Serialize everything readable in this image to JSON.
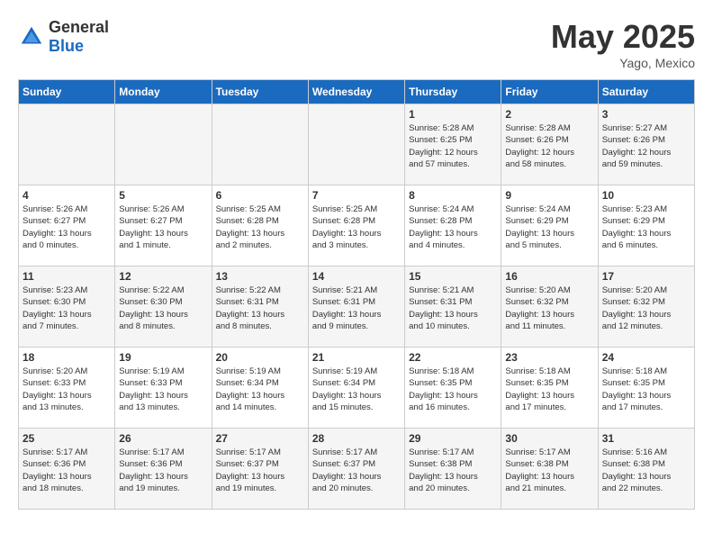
{
  "header": {
    "logo_general": "General",
    "logo_blue": "Blue",
    "month": "May 2025",
    "location": "Yago, Mexico"
  },
  "weekdays": [
    "Sunday",
    "Monday",
    "Tuesday",
    "Wednesday",
    "Thursday",
    "Friday",
    "Saturday"
  ],
  "weeks": [
    [
      {
        "day": "",
        "info": ""
      },
      {
        "day": "",
        "info": ""
      },
      {
        "day": "",
        "info": ""
      },
      {
        "day": "",
        "info": ""
      },
      {
        "day": "1",
        "info": "Sunrise: 5:28 AM\nSunset: 6:25 PM\nDaylight: 12 hours\nand 57 minutes."
      },
      {
        "day": "2",
        "info": "Sunrise: 5:28 AM\nSunset: 6:26 PM\nDaylight: 12 hours\nand 58 minutes."
      },
      {
        "day": "3",
        "info": "Sunrise: 5:27 AM\nSunset: 6:26 PM\nDaylight: 12 hours\nand 59 minutes."
      }
    ],
    [
      {
        "day": "4",
        "info": "Sunrise: 5:26 AM\nSunset: 6:27 PM\nDaylight: 13 hours\nand 0 minutes."
      },
      {
        "day": "5",
        "info": "Sunrise: 5:26 AM\nSunset: 6:27 PM\nDaylight: 13 hours\nand 1 minute."
      },
      {
        "day": "6",
        "info": "Sunrise: 5:25 AM\nSunset: 6:28 PM\nDaylight: 13 hours\nand 2 minutes."
      },
      {
        "day": "7",
        "info": "Sunrise: 5:25 AM\nSunset: 6:28 PM\nDaylight: 13 hours\nand 3 minutes."
      },
      {
        "day": "8",
        "info": "Sunrise: 5:24 AM\nSunset: 6:28 PM\nDaylight: 13 hours\nand 4 minutes."
      },
      {
        "day": "9",
        "info": "Sunrise: 5:24 AM\nSunset: 6:29 PM\nDaylight: 13 hours\nand 5 minutes."
      },
      {
        "day": "10",
        "info": "Sunrise: 5:23 AM\nSunset: 6:29 PM\nDaylight: 13 hours\nand 6 minutes."
      }
    ],
    [
      {
        "day": "11",
        "info": "Sunrise: 5:23 AM\nSunset: 6:30 PM\nDaylight: 13 hours\nand 7 minutes."
      },
      {
        "day": "12",
        "info": "Sunrise: 5:22 AM\nSunset: 6:30 PM\nDaylight: 13 hours\nand 8 minutes."
      },
      {
        "day": "13",
        "info": "Sunrise: 5:22 AM\nSunset: 6:31 PM\nDaylight: 13 hours\nand 8 minutes."
      },
      {
        "day": "14",
        "info": "Sunrise: 5:21 AM\nSunset: 6:31 PM\nDaylight: 13 hours\nand 9 minutes."
      },
      {
        "day": "15",
        "info": "Sunrise: 5:21 AM\nSunset: 6:31 PM\nDaylight: 13 hours\nand 10 minutes."
      },
      {
        "day": "16",
        "info": "Sunrise: 5:20 AM\nSunset: 6:32 PM\nDaylight: 13 hours\nand 11 minutes."
      },
      {
        "day": "17",
        "info": "Sunrise: 5:20 AM\nSunset: 6:32 PM\nDaylight: 13 hours\nand 12 minutes."
      }
    ],
    [
      {
        "day": "18",
        "info": "Sunrise: 5:20 AM\nSunset: 6:33 PM\nDaylight: 13 hours\nand 13 minutes."
      },
      {
        "day": "19",
        "info": "Sunrise: 5:19 AM\nSunset: 6:33 PM\nDaylight: 13 hours\nand 13 minutes."
      },
      {
        "day": "20",
        "info": "Sunrise: 5:19 AM\nSunset: 6:34 PM\nDaylight: 13 hours\nand 14 minutes."
      },
      {
        "day": "21",
        "info": "Sunrise: 5:19 AM\nSunset: 6:34 PM\nDaylight: 13 hours\nand 15 minutes."
      },
      {
        "day": "22",
        "info": "Sunrise: 5:18 AM\nSunset: 6:35 PM\nDaylight: 13 hours\nand 16 minutes."
      },
      {
        "day": "23",
        "info": "Sunrise: 5:18 AM\nSunset: 6:35 PM\nDaylight: 13 hours\nand 17 minutes."
      },
      {
        "day": "24",
        "info": "Sunrise: 5:18 AM\nSunset: 6:35 PM\nDaylight: 13 hours\nand 17 minutes."
      }
    ],
    [
      {
        "day": "25",
        "info": "Sunrise: 5:17 AM\nSunset: 6:36 PM\nDaylight: 13 hours\nand 18 minutes."
      },
      {
        "day": "26",
        "info": "Sunrise: 5:17 AM\nSunset: 6:36 PM\nDaylight: 13 hours\nand 19 minutes."
      },
      {
        "day": "27",
        "info": "Sunrise: 5:17 AM\nSunset: 6:37 PM\nDaylight: 13 hours\nand 19 minutes."
      },
      {
        "day": "28",
        "info": "Sunrise: 5:17 AM\nSunset: 6:37 PM\nDaylight: 13 hours\nand 20 minutes."
      },
      {
        "day": "29",
        "info": "Sunrise: 5:17 AM\nSunset: 6:38 PM\nDaylight: 13 hours\nand 20 minutes."
      },
      {
        "day": "30",
        "info": "Sunrise: 5:17 AM\nSunset: 6:38 PM\nDaylight: 13 hours\nand 21 minutes."
      },
      {
        "day": "31",
        "info": "Sunrise: 5:16 AM\nSunset: 6:38 PM\nDaylight: 13 hours\nand 22 minutes."
      }
    ]
  ]
}
